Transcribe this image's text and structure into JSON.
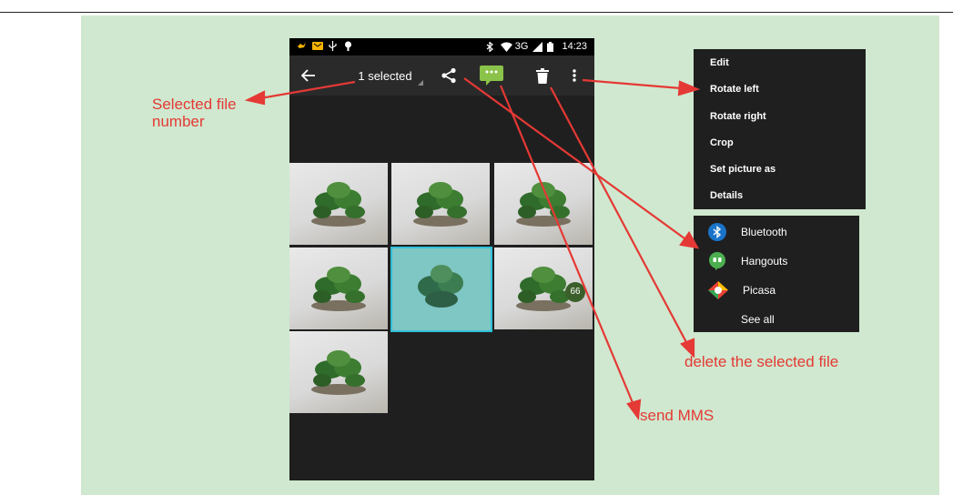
{
  "phone": {
    "status_time": "14:23",
    "status_network": "3G",
    "selection_label": "1 selected",
    "badge_count": "66"
  },
  "overflow_menu": {
    "items": [
      "Edit",
      "Rotate left",
      "Rotate right",
      "Crop",
      "Set picture as",
      "Details"
    ]
  },
  "share_menu": {
    "items": [
      {
        "label": "Bluetooth",
        "icon": "bluetooth-icon"
      },
      {
        "label": "Hangouts",
        "icon": "hangouts-icon"
      },
      {
        "label": "Picasa",
        "icon": "picasa-icon"
      },
      {
        "label": "See all",
        "icon": ""
      }
    ]
  },
  "annotations": {
    "selected_number": "Selected file\nnumber",
    "delete": "delete the selected file",
    "send_mms": "send MMS"
  },
  "colors": {
    "panel_bg": "#cfe8cf",
    "arrow": "#e53935",
    "selection_outline": "#2fc0d8",
    "mms_icon": "#8bc34a"
  }
}
